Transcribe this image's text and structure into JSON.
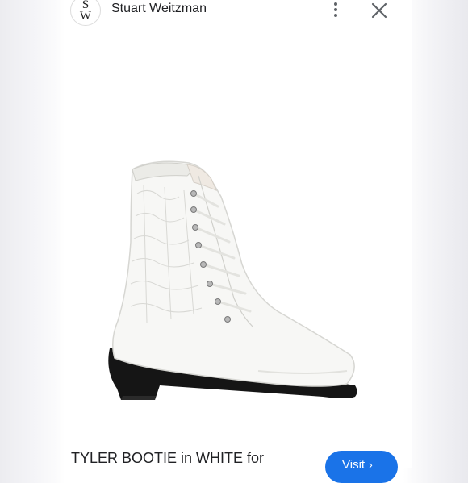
{
  "header": {
    "logo_top": "S",
    "logo_bottom": "W",
    "brand_name": "Stuart Weitzman"
  },
  "icons": {
    "more": "more-vert-icon",
    "close": "close-icon",
    "visit_chevron": "chevron-right-icon"
  },
  "product": {
    "title": "TYLER BOOTIE in WHITE for",
    "visit_label": "Visit",
    "visit_chevron": "›"
  },
  "colors": {
    "accent": "#1a73e8",
    "boot": "#f7f7f5",
    "sole": "#151515"
  }
}
